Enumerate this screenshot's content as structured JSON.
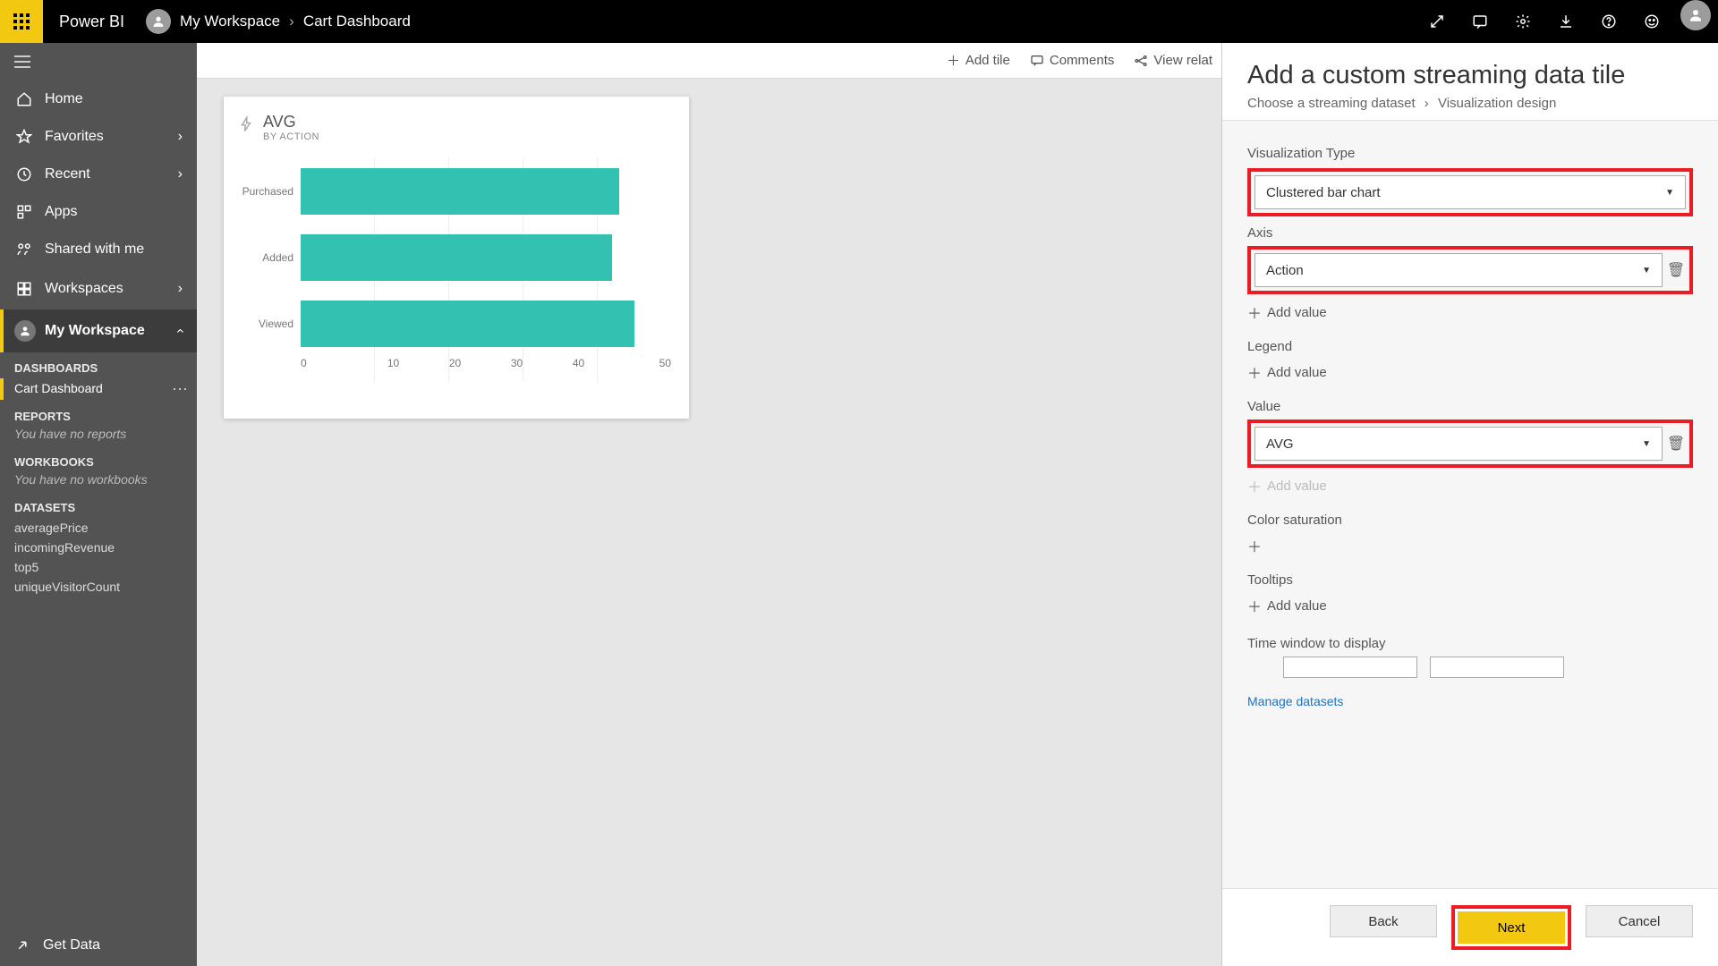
{
  "topbar": {
    "brand": "Power BI",
    "breadcrumb_workspace": "My Workspace",
    "breadcrumb_item": "Cart Dashboard"
  },
  "sidebar": {
    "home": "Home",
    "favorites": "Favorites",
    "recent": "Recent",
    "apps": "Apps",
    "shared": "Shared with me",
    "workspaces": "Workspaces",
    "my_workspace": "My Workspace",
    "dashboards_label": "DASHBOARDS",
    "dashboards_item": "Cart Dashboard",
    "reports_label": "REPORTS",
    "reports_empty": "You have no reports",
    "workbooks_label": "WORKBOOKS",
    "workbooks_empty": "You have no workbooks",
    "datasets_label": "DATASETS",
    "datasets": [
      "averagePrice",
      "incomingRevenue",
      "top5",
      "uniqueVisitorCount"
    ],
    "get_data": "Get Data"
  },
  "toolbar": {
    "add_tile": "Add tile",
    "comments": "Comments",
    "view_related": "View relat"
  },
  "tile": {
    "title": "AVG",
    "subtitle": "BY ACTION"
  },
  "chart_data": {
    "type": "bar",
    "orientation": "horizontal",
    "categories": [
      "Purchased",
      "Added",
      "Viewed"
    ],
    "values": [
      43,
      42,
      45
    ],
    "title": "AVG",
    "subtitle": "BY ACTION",
    "xlabel": "",
    "ylabel": "",
    "xlim": [
      0,
      50
    ],
    "xticks": [
      0,
      10,
      20,
      30,
      40,
      50
    ],
    "series_color": "#33c1b1"
  },
  "panel": {
    "title": "Add a custom streaming data tile",
    "crumb1": "Choose a streaming dataset",
    "crumb2": "Visualization design",
    "viz_type_label": "Visualization Type",
    "viz_type_value": "Clustered bar chart",
    "axis_label": "Axis",
    "axis_value": "Action",
    "legend_label": "Legend",
    "value_label": "Value",
    "value_value": "AVG",
    "color_sat_label": "Color saturation",
    "tooltips_label": "Tooltips",
    "add_value": "Add value",
    "time_window_label": "Time window to display",
    "manage_link": "Manage datasets",
    "back": "Back",
    "next": "Next",
    "cancel": "Cancel"
  }
}
